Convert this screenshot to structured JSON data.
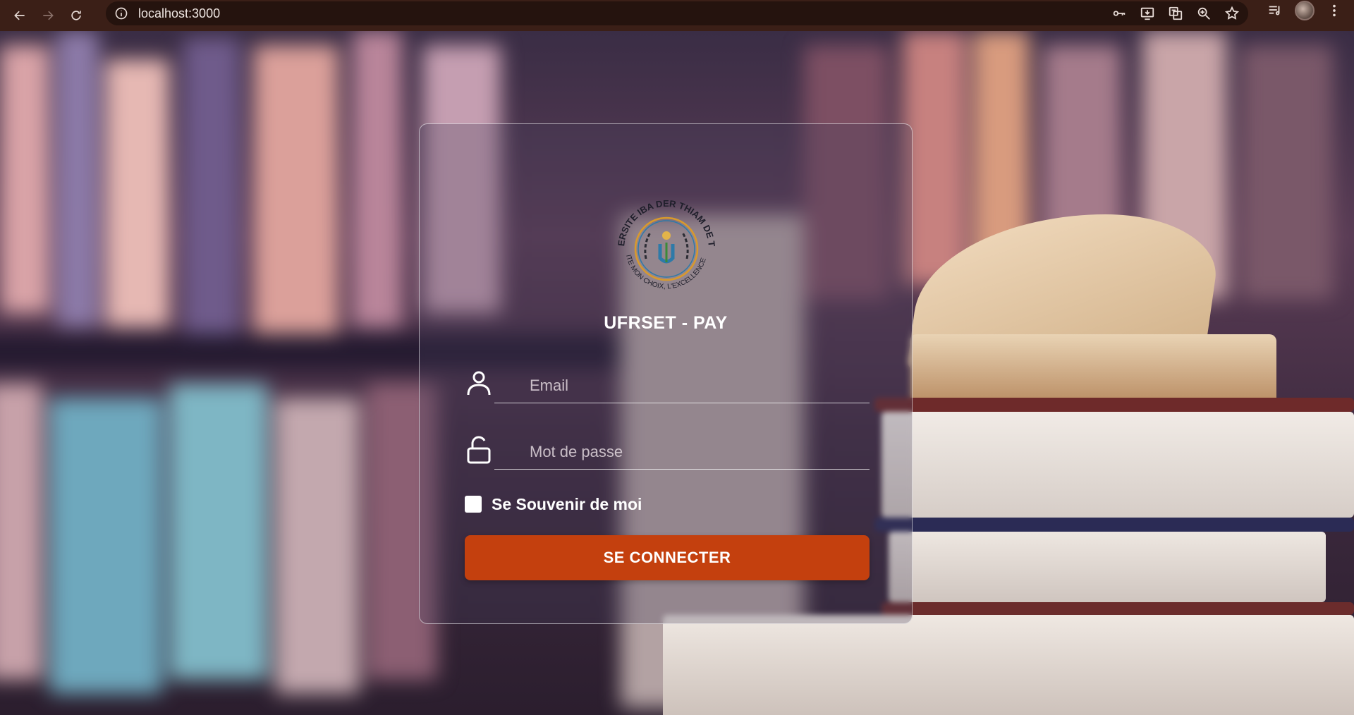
{
  "browser": {
    "url": "localhost:3000"
  },
  "login": {
    "logo_text_top": "UNIVERSITE IBA DER THIAM DE THIES",
    "logo_text_bottom": "L'HUMILITE MON CHOIX, L'EXCELLENCE MA VOIE",
    "title": "UFRSET - PAY",
    "email_placeholder": "Email",
    "password_placeholder": "Mot de passe",
    "remember_label": "Se Souvenir de moi",
    "remember_checked": false,
    "submit_label": "SE CONNECTER"
  },
  "colors": {
    "browser_bar": "#3b1f17",
    "submit_button": "#c4400e",
    "card_border": "#ffffff"
  },
  "icons": [
    "back-icon",
    "forward-icon",
    "reload-icon",
    "info-icon",
    "key-icon",
    "install-icon",
    "translate-icon",
    "zoom-icon",
    "star-icon",
    "reading-list-icon",
    "menu-icon",
    "user-icon",
    "unlock-icon"
  ]
}
